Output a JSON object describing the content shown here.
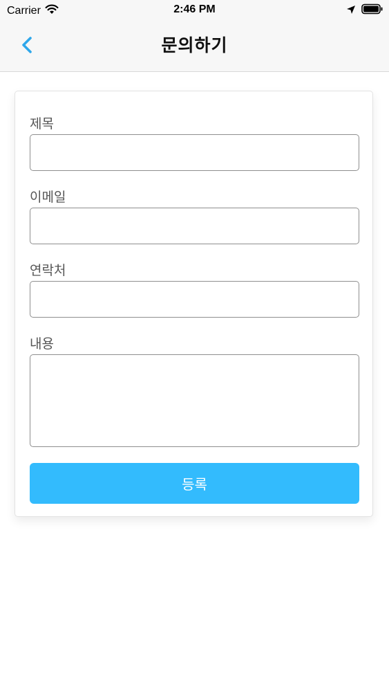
{
  "status_bar": {
    "carrier": "Carrier",
    "time": "2:46 PM"
  },
  "nav": {
    "title": "문의하기",
    "back_icon": "chevron-left-icon"
  },
  "form": {
    "fields": [
      {
        "label": "제목",
        "value": "",
        "placeholder": ""
      },
      {
        "label": "이메일",
        "value": "",
        "placeholder": ""
      },
      {
        "label": "연락처",
        "value": "",
        "placeholder": ""
      },
      {
        "label": "내용",
        "value": "",
        "placeholder": ""
      }
    ],
    "submit_label": "등록"
  },
  "colors": {
    "accent": "#33bbfd",
    "back_icon": "#2fa7ea",
    "nav_background": "#f7f7f7"
  }
}
